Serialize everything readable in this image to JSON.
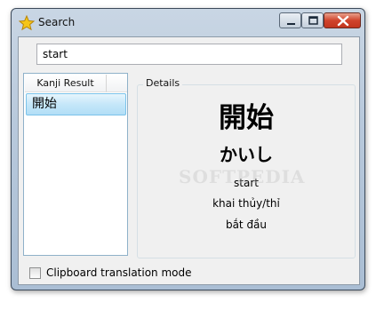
{
  "window": {
    "title": "Search"
  },
  "search": {
    "value": "start"
  },
  "results": {
    "column_header": "Kanji Result",
    "items": [
      {
        "kanji": "開始"
      }
    ]
  },
  "details": {
    "legend": "Details",
    "kanji": "開始",
    "reading": "かいし",
    "meanings": [
      "start",
      "khai thủy/thỉ",
      "bắt đầu"
    ]
  },
  "options": {
    "clipboard_label": "Clipboard translation mode",
    "clipboard_checked": false
  },
  "watermark": "SOFTPEDIA",
  "colors": {
    "selection_top": "#e6f5fd",
    "selection_bottom": "#b2def6",
    "close_button": "#d0442c"
  }
}
